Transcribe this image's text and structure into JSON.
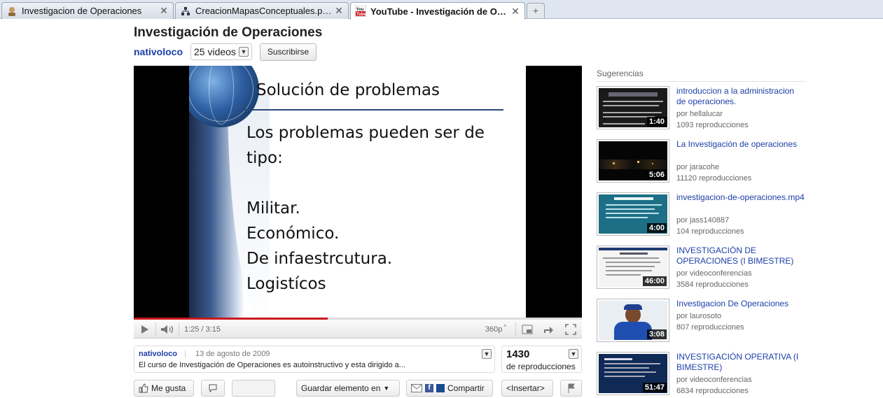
{
  "browser": {
    "tabs": [
      {
        "title": "Investigacion de Operaciones",
        "icon": "user-avatar-icon",
        "active": false
      },
      {
        "title": "CreacionMapasConceptuales.pdf (a...",
        "icon": "sitemap-icon",
        "active": false
      },
      {
        "title": "YouTube - Investigación de Oper...",
        "icon": "youtube-icon",
        "active": true
      }
    ],
    "new_tab_symbol": "+"
  },
  "playlist": {
    "title": "Investigación de Operaciones",
    "channel": "nativoloco",
    "video_count": "25 videos",
    "subscribe_label": "Suscribirse"
  },
  "video": {
    "slide": {
      "title": "Solución de problemas",
      "lines": [
        "Los problemas pueden ser de",
        "tipo:",
        "",
        "Militar.",
        "Económico.",
        "De infaestrcutura.",
        "Logistícos"
      ]
    },
    "time": "1:25 / 3:15",
    "quality": "360p",
    "progress_fraction": 0.433,
    "buffered_fraction": 0.43
  },
  "info": {
    "channel": "nativoloco",
    "separator": "|",
    "date": "13 de agosto de 2009",
    "description": "El curso de Investigación de Operaciones es autoinstructivo y esta dirigido a...",
    "views_count": "1430",
    "views_label": "de reproducciones"
  },
  "actions": {
    "like": "Me gusta",
    "save": "Guardar elemento en",
    "share": "Compartir",
    "embed": "<Insertar>"
  },
  "sidebar": {
    "heading": "Sugerencias",
    "items": [
      {
        "title": "introduccion a la administracion de operaciones.",
        "author": "por hellalucar",
        "views": "1093 reproducciones",
        "duration": "1:40"
      },
      {
        "title": "La Investigación de operaciones",
        "author": "por jaracohe",
        "views": "11120 reproducciones",
        "duration": "5:06"
      },
      {
        "title": "investigacion-de-operaciones.mp4",
        "author": "por jass140887",
        "views": "104 reproducciones",
        "duration": "4:00"
      },
      {
        "title": "INVESTIGACIÓN DE OPERACIONES (I BIMESTRE)",
        "author": "por videoconferencias",
        "views": "3584 reproducciones",
        "duration": "46:00"
      },
      {
        "title": "Investigacion De Operaciones",
        "author": "por laurosoto",
        "views": "807 reproducciones",
        "duration": "3:08"
      },
      {
        "title": "INVESTIGACIÓN OPERATIVA (I BIMESTRE)",
        "author": "por videoconferencias",
        "views": "6834 reproducciones",
        "duration": "51:47"
      }
    ]
  },
  "colors": {
    "link": "#1c3fa8",
    "progress": "#cc181e"
  }
}
